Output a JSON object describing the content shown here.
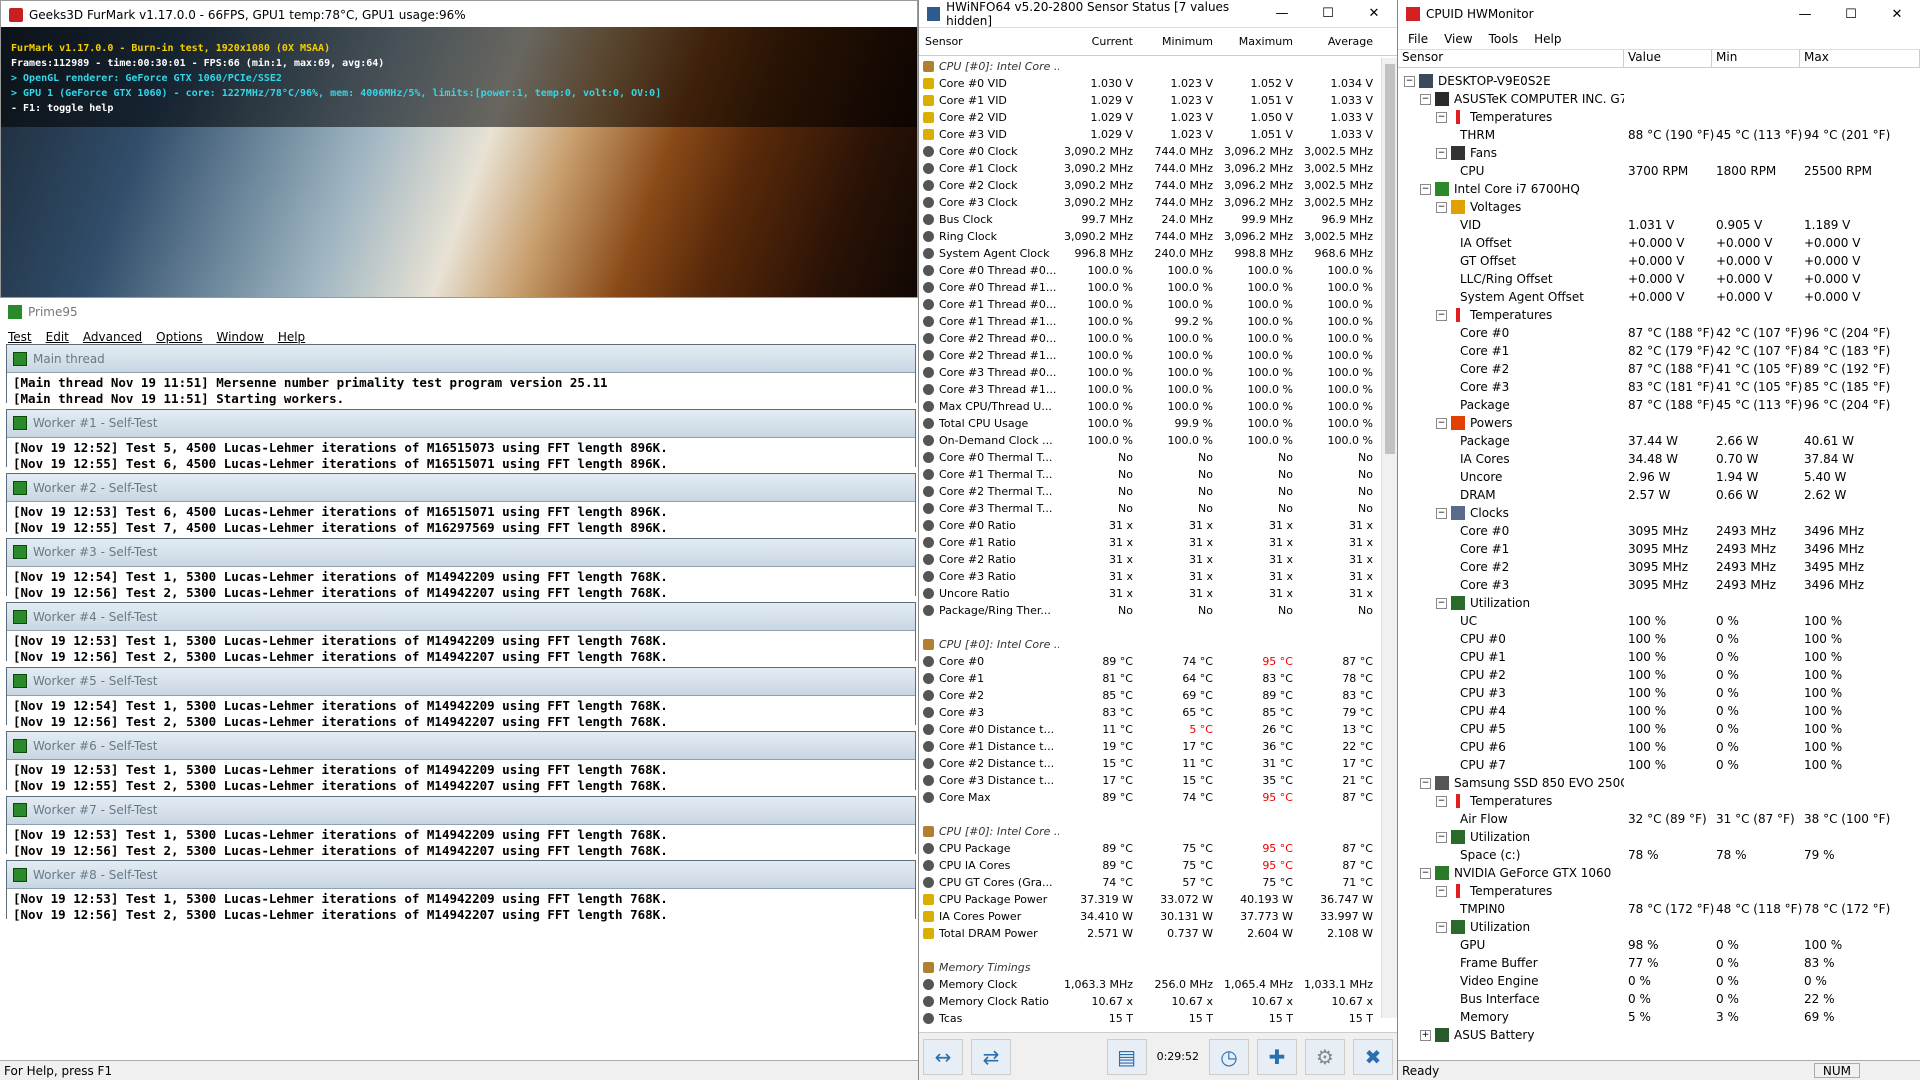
{
  "furmark": {
    "title": "Geeks3D FurMark v1.17.0.0 - 66FPS, GPU1 temp:78°C, GPU1 usage:96%",
    "lines": [
      {
        "text": "FurMark v1.17.0.0 - Burn-in test, 1920x1080 (0X MSAA)",
        "color": "#f5d000"
      },
      {
        "text": "Frames:112989 - time:00:30:01 - FPS:66 (min:1, max:69, avg:64)",
        "color": "#ffffff"
      },
      {
        "text": "> OpenGL renderer: GeForce GTX 1060/PCIe/SSE2",
        "color": "#33d6e8"
      },
      {
        "text": "> GPU 1 (GeForce GTX 1060) - core: 1227MHz/78°C/96%, mem: 4006MHz/5%, limits:[power:1, temp:0, volt:0, OV:0]",
        "color": "#33d6e8"
      },
      {
        "text": "- F1: toggle help",
        "color": "#ffffff"
      }
    ]
  },
  "prime95": {
    "title": "Prime95",
    "menu": [
      "Test",
      "Edit",
      "Advanced",
      "Options",
      "Window",
      "Help"
    ],
    "sections": [
      {
        "title": "Main thread",
        "lines": [
          "[Main thread Nov 19 11:51] Mersenne number primality test program version 25.11",
          "[Main thread Nov 19 11:51] Starting workers."
        ]
      },
      {
        "title": "Worker #1 - Self-Test",
        "lines": [
          "[Nov 19 12:52] Test 5, 4500 Lucas-Lehmer iterations of M16515073 using FFT length 896K.",
          "[Nov 19 12:55] Test 6, 4500 Lucas-Lehmer iterations of M16515071 using FFT length 896K."
        ]
      },
      {
        "title": "Worker #2 - Self-Test",
        "lines": [
          "[Nov 19 12:53] Test 6, 4500 Lucas-Lehmer iterations of M16515071 using FFT length 896K.",
          "[Nov 19 12:55] Test 7, 4500 Lucas-Lehmer iterations of M16297569 using FFT length 896K."
        ]
      },
      {
        "title": "Worker #3 - Self-Test",
        "lines": [
          "[Nov 19 12:54] Test 1, 5300 Lucas-Lehmer iterations of M14942209 using FFT length 768K.",
          "[Nov 19 12:56] Test 2, 5300 Lucas-Lehmer iterations of M14942207 using FFT length 768K."
        ]
      },
      {
        "title": "Worker #4 - Self-Test",
        "lines": [
          "[Nov 19 12:53] Test 1, 5300 Lucas-Lehmer iterations of M14942209 using FFT length 768K.",
          "[Nov 19 12:56] Test 2, 5300 Lucas-Lehmer iterations of M14942207 using FFT length 768K."
        ]
      },
      {
        "title": "Worker #5 - Self-Test",
        "lines": [
          "[Nov 19 12:54] Test 1, 5300 Lucas-Lehmer iterations of M14942209 using FFT length 768K.",
          "[Nov 19 12:56] Test 2, 5300 Lucas-Lehmer iterations of M14942207 using FFT length 768K."
        ]
      },
      {
        "title": "Worker #6 - Self-Test",
        "lines": [
          "[Nov 19 12:53] Test 1, 5300 Lucas-Lehmer iterations of M14942209 using FFT length 768K.",
          "[Nov 19 12:55] Test 2, 5300 Lucas-Lehmer iterations of M14942207 using FFT length 768K."
        ]
      },
      {
        "title": "Worker #7 - Self-Test",
        "lines": [
          "[Nov 19 12:53] Test 1, 5300 Lucas-Lehmer iterations of M14942209 using FFT length 768K.",
          "[Nov 19 12:56] Test 2, 5300 Lucas-Lehmer iterations of M14942207 using FFT length 768K."
        ]
      },
      {
        "title": "Worker #8 - Self-Test",
        "lines": [
          "[Nov 19 12:53] Test 1, 5300 Lucas-Lehmer iterations of M14942209 using FFT length 768K.",
          "[Nov 19 12:56] Test 2, 5300 Lucas-Lehmer iterations of M14942207 using FFT length 768K."
        ]
      }
    ],
    "status": "For Help, press F1"
  },
  "hwinfo": {
    "title": "HWiNFO64 v5.20-2800 Sensor Status [7 values hidden]",
    "columns": [
      "Sensor",
      "Current",
      "Minimum",
      "Maximum",
      "Average"
    ],
    "rows": [
      {
        "g": true,
        "s": "CPU [#0]: Intel Core ..."
      },
      {
        "s": "Core #0 VID",
        "v": [
          "1.030 V",
          "1.023 V",
          "1.052 V",
          "1.034 V"
        ]
      },
      {
        "s": "Core #1 VID",
        "v": [
          "1.029 V",
          "1.023 V",
          "1.051 V",
          "1.033 V"
        ]
      },
      {
        "s": "Core #2 VID",
        "v": [
          "1.029 V",
          "1.023 V",
          "1.050 V",
          "1.033 V"
        ]
      },
      {
        "s": "Core #3 VID",
        "v": [
          "1.029 V",
          "1.023 V",
          "1.051 V",
          "1.033 V"
        ]
      },
      {
        "s": "Core #0 Clock",
        "v": [
          "3,090.2 MHz",
          "744.0 MHz",
          "3,096.2 MHz",
          "3,002.5 MHz"
        ]
      },
      {
        "s": "Core #1 Clock",
        "v": [
          "3,090.2 MHz",
          "744.0 MHz",
          "3,096.2 MHz",
          "3,002.5 MHz"
        ]
      },
      {
        "s": "Core #2 Clock",
        "v": [
          "3,090.2 MHz",
          "744.0 MHz",
          "3,096.2 MHz",
          "3,002.5 MHz"
        ]
      },
      {
        "s": "Core #3 Clock",
        "v": [
          "3,090.2 MHz",
          "744.0 MHz",
          "3,096.2 MHz",
          "3,002.5 MHz"
        ]
      },
      {
        "s": "Bus Clock",
        "v": [
          "99.7 MHz",
          "24.0 MHz",
          "99.9 MHz",
          "96.9 MHz"
        ]
      },
      {
        "s": "Ring Clock",
        "v": [
          "3,090.2 MHz",
          "744.0 MHz",
          "3,096.2 MHz",
          "3,002.5 MHz"
        ]
      },
      {
        "s": "System Agent Clock",
        "v": [
          "996.8 MHz",
          "240.0 MHz",
          "998.8 MHz",
          "968.6 MHz"
        ]
      },
      {
        "s": "Core #0 Thread #0...",
        "v": [
          "100.0 %",
          "100.0 %",
          "100.0 %",
          "100.0 %"
        ]
      },
      {
        "s": "Core #0 Thread #1...",
        "v": [
          "100.0 %",
          "100.0 %",
          "100.0 %",
          "100.0 %"
        ]
      },
      {
        "s": "Core #1 Thread #0...",
        "v": [
          "100.0 %",
          "100.0 %",
          "100.0 %",
          "100.0 %"
        ]
      },
      {
        "s": "Core #1 Thread #1...",
        "v": [
          "100.0 %",
          "99.2 %",
          "100.0 %",
          "100.0 %"
        ]
      },
      {
        "s": "Core #2 Thread #0...",
        "v": [
          "100.0 %",
          "100.0 %",
          "100.0 %",
          "100.0 %"
        ]
      },
      {
        "s": "Core #2 Thread #1...",
        "v": [
          "100.0 %",
          "100.0 %",
          "100.0 %",
          "100.0 %"
        ]
      },
      {
        "s": "Core #3 Thread #0...",
        "v": [
          "100.0 %",
          "100.0 %",
          "100.0 %",
          "100.0 %"
        ]
      },
      {
        "s": "Core #3 Thread #1...",
        "v": [
          "100.0 %",
          "100.0 %",
          "100.0 %",
          "100.0 %"
        ]
      },
      {
        "s": "Max CPU/Thread U...",
        "v": [
          "100.0 %",
          "100.0 %",
          "100.0 %",
          "100.0 %"
        ]
      },
      {
        "s": "Total CPU Usage",
        "v": [
          "100.0 %",
          "99.9 %",
          "100.0 %",
          "100.0 %"
        ]
      },
      {
        "s": "On-Demand Clock ...",
        "v": [
          "100.0 %",
          "100.0 %",
          "100.0 %",
          "100.0 %"
        ]
      },
      {
        "s": "Core #0 Thermal T...",
        "v": [
          "No",
          "No",
          "No",
          "No"
        ]
      },
      {
        "s": "Core #1 Thermal T...",
        "v": [
          "No",
          "No",
          "No",
          "No"
        ]
      },
      {
        "s": "Core #2 Thermal T...",
        "v": [
          "No",
          "No",
          "No",
          "No"
        ]
      },
      {
        "s": "Core #3 Thermal T...",
        "v": [
          "No",
          "No",
          "No",
          "No"
        ]
      },
      {
        "s": "Core #0 Ratio",
        "v": [
          "31 x",
          "31 x",
          "31 x",
          "31 x"
        ]
      },
      {
        "s": "Core #1 Ratio",
        "v": [
          "31 x",
          "31 x",
          "31 x",
          "31 x"
        ]
      },
      {
        "s": "Core #2 Ratio",
        "v": [
          "31 x",
          "31 x",
          "31 x",
          "31 x"
        ]
      },
      {
        "s": "Core #3 Ratio",
        "v": [
          "31 x",
          "31 x",
          "31 x",
          "31 x"
        ]
      },
      {
        "s": "Uncore Ratio",
        "v": [
          "31 x",
          "31 x",
          "31 x",
          "31 x"
        ]
      },
      {
        "s": "Package/Ring Ther...",
        "v": [
          "No",
          "No",
          "No",
          "No"
        ]
      },
      {
        "blank": true
      },
      {
        "g": true,
        "s": "CPU [#0]: Intel Core ..."
      },
      {
        "s": "Core #0",
        "v": [
          "89 °C",
          "74 °C",
          "95 °C",
          "87 °C"
        ],
        "red": [
          2
        ]
      },
      {
        "s": "Core #1",
        "v": [
          "81 °C",
          "64 °C",
          "83 °C",
          "78 °C"
        ]
      },
      {
        "s": "Core #2",
        "v": [
          "85 °C",
          "69 °C",
          "89 °C",
          "83 °C"
        ]
      },
      {
        "s": "Core #3",
        "v": [
          "83 °C",
          "65 °C",
          "85 °C",
          "79 °C"
        ]
      },
      {
        "s": "Core #0 Distance t...",
        "v": [
          "11 °C",
          "5 °C",
          "26 °C",
          "13 °C"
        ],
        "red": [
          1
        ]
      },
      {
        "s": "Core #1 Distance t...",
        "v": [
          "19 °C",
          "17 °C",
          "36 °C",
          "22 °C"
        ]
      },
      {
        "s": "Core #2 Distance t...",
        "v": [
          "15 °C",
          "11 °C",
          "31 °C",
          "17 °C"
        ]
      },
      {
        "s": "Core #3 Distance t...",
        "v": [
          "17 °C",
          "15 °C",
          "35 °C",
          "21 °C"
        ]
      },
      {
        "s": "Core Max",
        "v": [
          "89 °C",
          "74 °C",
          "95 °C",
          "87 °C"
        ],
        "red": [
          2
        ]
      },
      {
        "blank": true
      },
      {
        "g": true,
        "s": "CPU [#0]: Intel Core ..."
      },
      {
        "s": "CPU Package",
        "v": [
          "89 °C",
          "75 °C",
          "95 °C",
          "87 °C"
        ],
        "red": [
          2
        ]
      },
      {
        "s": "CPU IA Cores",
        "v": [
          "89 °C",
          "75 °C",
          "95 °C",
          "87 °C"
        ],
        "red": [
          2
        ]
      },
      {
        "s": "CPU GT Cores (Gra...",
        "v": [
          "74 °C",
          "57 °C",
          "75 °C",
          "71 °C"
        ]
      },
      {
        "s": "CPU Package Power",
        "v": [
          "37.319 W",
          "33.072 W",
          "40.193 W",
          "36.747 W"
        ]
      },
      {
        "s": "IA Cores Power",
        "v": [
          "34.410 W",
          "30.131 W",
          "37.773 W",
          "33.997 W"
        ]
      },
      {
        "s": "Total DRAM Power",
        "v": [
          "2.571 W",
          "0.737 W",
          "2.604 W",
          "2.108 W"
        ]
      },
      {
        "blank": true
      },
      {
        "g": true,
        "s": "Memory Timings"
      },
      {
        "s": "Memory Clock",
        "v": [
          "1,063.3 MHz",
          "256.0 MHz",
          "1,065.4 MHz",
          "1,033.1 MHz"
        ]
      },
      {
        "s": "Memory Clock Ratio",
        "v": [
          "10.67 x",
          "10.67 x",
          "10.67 x",
          "10.67 x"
        ]
      },
      {
        "s": "Tcas",
        "v": [
          "15 T",
          "15 T",
          "15 T",
          "15 T"
        ]
      }
    ],
    "elapsed": "0:29:52"
  },
  "cpuid": {
    "title": "CPUID HWMonitor",
    "menu": [
      "File",
      "View",
      "Tools",
      "Help"
    ],
    "columns": [
      "Sensor",
      "Value",
      "Min",
      "Max"
    ],
    "rows": [
      {
        "l": 0,
        "n": "DESKTOP-V9E0S2E",
        "ico": "pc"
      },
      {
        "l": 1,
        "n": "ASUSTeK COMPUTER INC. G7...",
        "ico": "board"
      },
      {
        "l": 2,
        "n": "Temperatures",
        "ico": "temp"
      },
      {
        "l": 3,
        "n": "THRM",
        "v": "88 °C  (190 °F)",
        "mn": "45 °C  (113 °F)",
        "mx": "94 °C  (201 °F)"
      },
      {
        "l": 2,
        "n": "Fans",
        "ico": "fan"
      },
      {
        "l": 3,
        "n": "CPU",
        "v": "3700 RPM",
        "mn": "1800 RPM",
        "mx": "25500 RPM"
      },
      {
        "l": 1,
        "n": "Intel Core i7 6700HQ",
        "ico": "chip"
      },
      {
        "l": 2,
        "n": "Voltages",
        "ico": "volt"
      },
      {
        "l": 3,
        "n": "VID",
        "v": "1.031 V",
        "mn": "0.905 V",
        "mx": "1.189 V"
      },
      {
        "l": 3,
        "n": "IA Offset",
        "v": "+0.000 V",
        "mn": "+0.000 V",
        "mx": "+0.000 V"
      },
      {
        "l": 3,
        "n": "GT Offset",
        "v": "+0.000 V",
        "mn": "+0.000 V",
        "mx": "+0.000 V"
      },
      {
        "l": 3,
        "n": "LLC/Ring Offset",
        "v": "+0.000 V",
        "mn": "+0.000 V",
        "mx": "+0.000 V"
      },
      {
        "l": 3,
        "n": "System Agent Offset",
        "v": "+0.000 V",
        "mn": "+0.000 V",
        "mx": "+0.000 V"
      },
      {
        "l": 2,
        "n": "Temperatures",
        "ico": "temp"
      },
      {
        "l": 3,
        "n": "Core #0",
        "v": "87 °C  (188 °F)",
        "mn": "42 °C  (107 °F)",
        "mx": "96 °C  (204 °F)"
      },
      {
        "l": 3,
        "n": "Core #1",
        "v": "82 °C  (179 °F)",
        "mn": "42 °C  (107 °F)",
        "mx": "84 °C  (183 °F)"
      },
      {
        "l": 3,
        "n": "Core #2",
        "v": "87 °C  (188 °F)",
        "mn": "41 °C  (105 °F)",
        "mx": "89 °C  (192 °F)"
      },
      {
        "l": 3,
        "n": "Core #3",
        "v": "83 °C  (181 °F)",
        "mn": "41 °C  (105 °F)",
        "mx": "85 °C  (185 °F)"
      },
      {
        "l": 3,
        "n": "Package",
        "v": "87 °C  (188 °F)",
        "mn": "45 °C  (113 °F)",
        "mx": "96 °C  (204 °F)"
      },
      {
        "l": 2,
        "n": "Powers",
        "ico": "power"
      },
      {
        "l": 3,
        "n": "Package",
        "v": "37.44 W",
        "mn": "2.66 W",
        "mx": "40.61 W"
      },
      {
        "l": 3,
        "n": "IA Cores",
        "v": "34.48 W",
        "mn": "0.70 W",
        "mx": "37.84 W"
      },
      {
        "l": 3,
        "n": "Uncore",
        "v": "2.96 W",
        "mn": "1.94 W",
        "mx": "5.40 W"
      },
      {
        "l": 3,
        "n": "DRAM",
        "v": "2.57 W",
        "mn": "0.66 W",
        "mx": "2.62 W"
      },
      {
        "l": 2,
        "n": "Clocks",
        "ico": "clock"
      },
      {
        "l": 3,
        "n": "Core #0",
        "v": "3095 MHz",
        "mn": "2493 MHz",
        "mx": "3496 MHz"
      },
      {
        "l": 3,
        "n": "Core #1",
        "v": "3095 MHz",
        "mn": "2493 MHz",
        "mx": "3496 MHz"
      },
      {
        "l": 3,
        "n": "Core #2",
        "v": "3095 MHz",
        "mn": "2493 MHz",
        "mx": "3495 MHz"
      },
      {
        "l": 3,
        "n": "Core #3",
        "v": "3095 MHz",
        "mn": "2493 MHz",
        "mx": "3496 MHz"
      },
      {
        "l": 2,
        "n": "Utilization",
        "ico": "util"
      },
      {
        "l": 3,
        "n": "UC",
        "v": "100 %",
        "mn": "0 %",
        "mx": "100 %"
      },
      {
        "l": 3,
        "n": "CPU #0",
        "v": "100 %",
        "mn": "0 %",
        "mx": "100 %"
      },
      {
        "l": 3,
        "n": "CPU #1",
        "v": "100 %",
        "mn": "0 %",
        "mx": "100 %"
      },
      {
        "l": 3,
        "n": "CPU #2",
        "v": "100 %",
        "mn": "0 %",
        "mx": "100 %"
      },
      {
        "l": 3,
        "n": "CPU #3",
        "v": "100 %",
        "mn": "0 %",
        "mx": "100 %"
      },
      {
        "l": 3,
        "n": "CPU #4",
        "v": "100 %",
        "mn": "0 %",
        "mx": "100 %"
      },
      {
        "l": 3,
        "n": "CPU #5",
        "v": "100 %",
        "mn": "0 %",
        "mx": "100 %"
      },
      {
        "l": 3,
        "n": "CPU #6",
        "v": "100 %",
        "mn": "0 %",
        "mx": "100 %"
      },
      {
        "l": 3,
        "n": "CPU #7",
        "v": "100 %",
        "mn": "0 %",
        "mx": "100 %"
      },
      {
        "l": 1,
        "n": "Samsung SSD 850 EVO 250GB",
        "ico": "disk"
      },
      {
        "l": 2,
        "n": "Temperatures",
        "ico": "temp"
      },
      {
        "l": 3,
        "n": "Air Flow",
        "v": "32 °C  (89 °F)",
        "mn": "31 °C  (87 °F)",
        "mx": "38 °C  (100 °F)"
      },
      {
        "l": 2,
        "n": "Utilization",
        "ico": "util"
      },
      {
        "l": 3,
        "n": "Space (c:)",
        "v": "78 %",
        "mn": "78 %",
        "mx": "79 %"
      },
      {
        "l": 1,
        "n": "NVIDIA GeForce GTX 1060",
        "ico": "gpu"
      },
      {
        "l": 2,
        "n": "Temperatures",
        "ico": "temp"
      },
      {
        "l": 3,
        "n": "TMPIN0",
        "v": "78 °C  (172 °F)",
        "mn": "48 °C  (118 °F)",
        "mx": "78 °C  (172 °F)"
      },
      {
        "l": 2,
        "n": "Utilization",
        "ico": "util"
      },
      {
        "l": 3,
        "n": "GPU",
        "v": "98 %",
        "mn": "0 %",
        "mx": "100 %"
      },
      {
        "l": 3,
        "n": "Frame Buffer",
        "v": "77 %",
        "mn": "0 %",
        "mx": "83 %"
      },
      {
        "l": 3,
        "n": "Video Engine",
        "v": "0 %",
        "mn": "0 %",
        "mx": "0 %"
      },
      {
        "l": 3,
        "n": "Bus Interface",
        "v": "0 %",
        "mn": "0 %",
        "mx": "22 %"
      },
      {
        "l": 3,
        "n": "Memory",
        "v": "5 %",
        "mn": "3 %",
        "mx": "69 %"
      },
      {
        "l": 1,
        "n": "ASUS Battery",
        "ico": "battery",
        "collapsed": true
      }
    ],
    "status": "Ready",
    "num": "NUM"
  }
}
